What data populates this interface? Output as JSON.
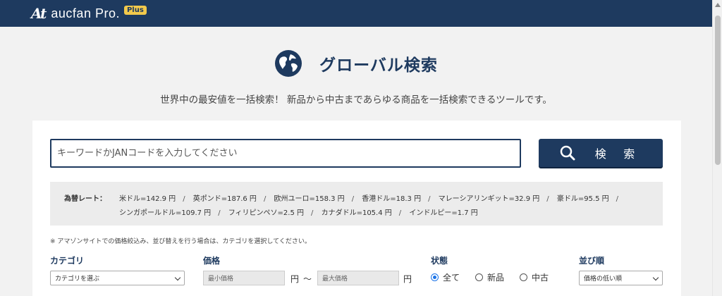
{
  "header": {
    "logo_mark": "At",
    "logo_text": "aucfan Pro.",
    "logo_badge": "Plus"
  },
  "hero": {
    "title": "グローバル検索",
    "subtitle": "世界中の最安値を一括検索！ 新品から中古まであらゆる商品を一括検索できるツールです。"
  },
  "search": {
    "placeholder": "キーワードかJANコードを入力してください",
    "button_label": "検 索"
  },
  "rates": {
    "label": "為替レート：",
    "line1": [
      "米ドル=142.9 円",
      "英ポンド=187.6 円",
      "欧州ユーロ=158.3 円",
      "香港ドル=18.3 円",
      "マレーシアリンギット=32.9 円",
      "豪ドル=95.5 円"
    ],
    "line2": [
      "シンガポールドル=109.7 円",
      "フィリピンペソ=2.5 円",
      "カナダドル=105.4 円",
      "インドルピー=1.7 円"
    ]
  },
  "note": "※ アマゾンサイトでの価格絞込み、並び替えを行う場合は、カテゴリを選択してください。",
  "filters": {
    "category": {
      "label": "カテゴリ",
      "selected": "カテゴリを選ぶ"
    },
    "price": {
      "label": "価格",
      "min_placeholder": "最小価格",
      "max_placeholder": "最大価格",
      "unit": "円",
      "range_sep": "〜"
    },
    "condition": {
      "label": "状態",
      "options": [
        "全て",
        "新品",
        "中古"
      ],
      "selected_index": 0
    },
    "sort": {
      "label": "並び順",
      "selected": "価格の低い順"
    }
  },
  "colors": {
    "brand_navy": "#1e3a5f",
    "badge_yellow": "#f2c94c",
    "radio_blue": "#1a73e8"
  },
  "icons": {
    "globe": "globe-icon",
    "search": "search-icon"
  }
}
